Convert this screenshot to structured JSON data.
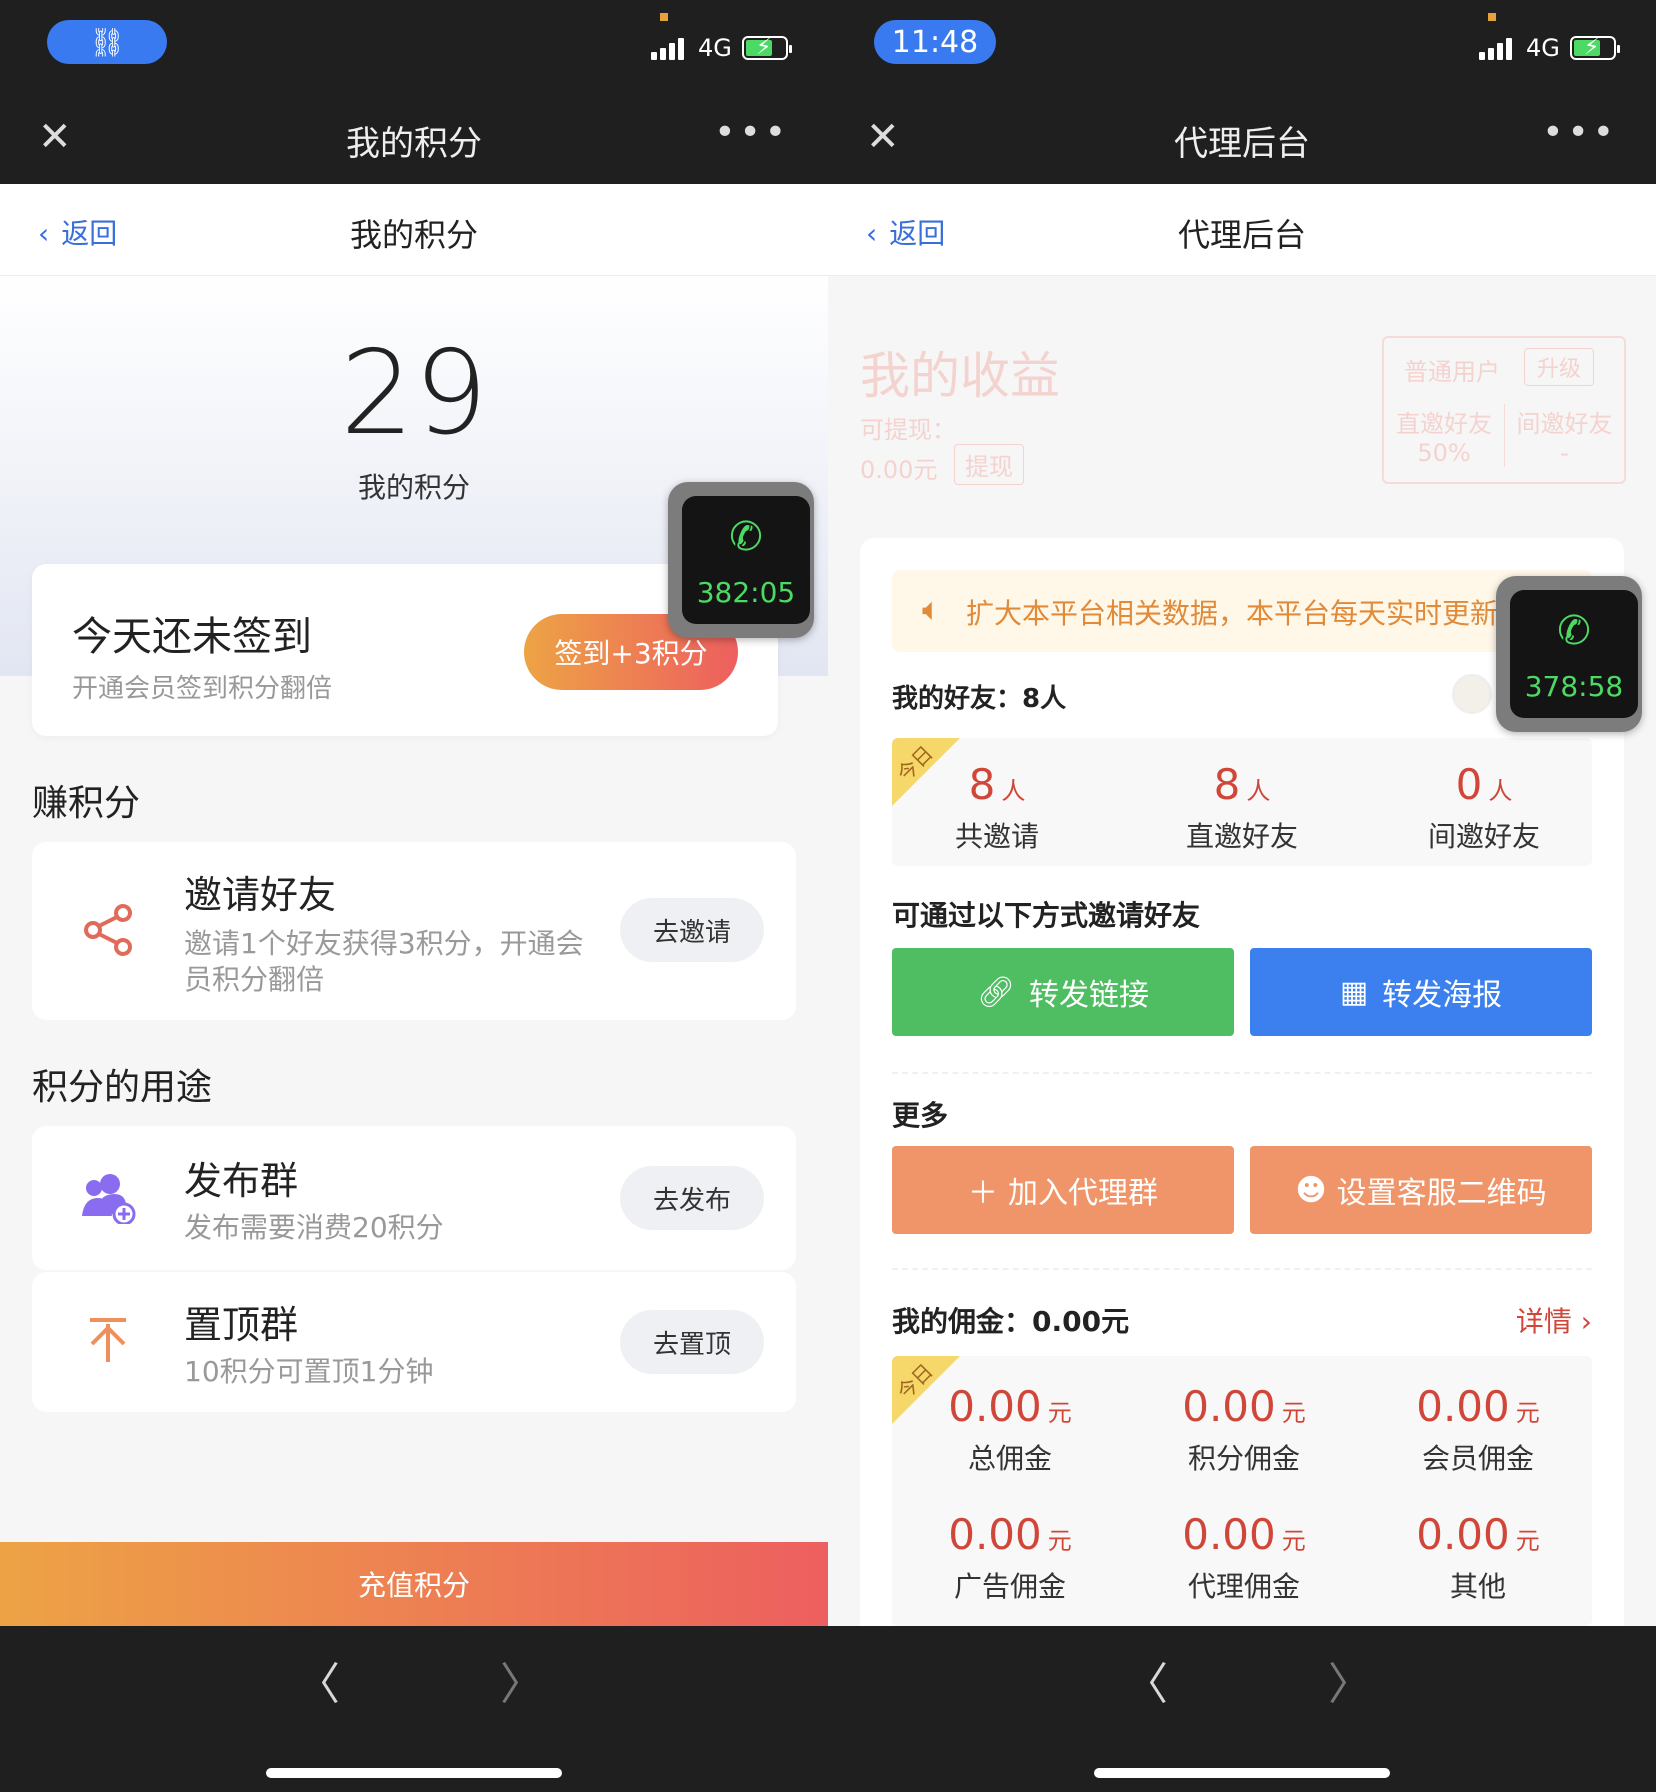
{
  "left": {
    "status": {
      "link_glyph": "⛓",
      "network": "4G"
    },
    "wx_title": "我的积分",
    "nav": {
      "back_label": "返回",
      "title": "我的积分"
    },
    "points": {
      "value": "29",
      "label": "我的积分"
    },
    "sign": {
      "title": "今天还未签到",
      "subtitle": "开通会员签到积分翻倍",
      "button": "签到+3积分"
    },
    "earn": {
      "heading": "赚积分",
      "items": [
        {
          "icon": "share-icon",
          "title": "邀请好友",
          "desc": "邀请1个好友获得3积分，开通会员积分翻倍",
          "action": "去邀请"
        }
      ]
    },
    "use": {
      "heading": "积分的用途",
      "items": [
        {
          "icon": "group-add-icon",
          "title": "发布群",
          "desc": "发布需要消费20积分",
          "action": "去发布"
        },
        {
          "icon": "pin-top-icon",
          "title": "置顶群",
          "desc": "10积分可置顶1分钟",
          "action": "去置顶"
        }
      ]
    },
    "recharge": "充值积分",
    "call": {
      "time": "382:05"
    }
  },
  "right": {
    "status": {
      "time": "11:48",
      "network": "4G"
    },
    "wx_title": "代理后台",
    "nav": {
      "back_label": "返回",
      "title": "代理后台"
    },
    "earnings": {
      "title": "我的收益",
      "withdrawable_label": "可提现：",
      "withdrawable_value": "0.00元",
      "withdraw_button": "提现",
      "level": "普通用户",
      "upgrade": "升级",
      "direct_label": "直邀好友",
      "direct_value": "50%",
      "indirect_label": "间邀好友",
      "indirect_value": "-"
    },
    "notice": "扩大本平台相关数据，本平台每天实时更新",
    "friends": {
      "label": "我的好友：",
      "count": "8人",
      "badge": "今日",
      "stats": [
        {
          "value": "8",
          "unit": "人",
          "label": "共邀请"
        },
        {
          "value": "8",
          "unit": "人",
          "label": "直邀好友"
        },
        {
          "value": "0",
          "unit": "人",
          "label": "间邀好友"
        }
      ]
    },
    "invite": {
      "heading": "可通过以下方式邀请好友",
      "link_button": "转发链接",
      "poster_button": "转发海报"
    },
    "more": {
      "heading": "更多",
      "join_button": "加入代理群",
      "qr_button": "设置客服二维码"
    },
    "commission": {
      "label": "我的佣金：",
      "value": "0.00元",
      "detail": "详情",
      "badge": "今日",
      "stats": [
        {
          "value": "0.00",
          "unit": "元",
          "label": "总佣金"
        },
        {
          "value": "0.00",
          "unit": "元",
          "label": "积分佣金"
        },
        {
          "value": "0.00",
          "unit": "元",
          "label": "会员佣金"
        },
        {
          "value": "0.00",
          "unit": "元",
          "label": "广告佣金"
        },
        {
          "value": "0.00",
          "unit": "元",
          "label": "代理佣金"
        },
        {
          "value": "0.00",
          "unit": "元",
          "label": "其他"
        }
      ]
    },
    "call": {
      "time": "378:58"
    }
  },
  "colors": {
    "accent_orange": "#eda345",
    "accent_red": "#ed5f5f",
    "green": "#4fbd62",
    "blue": "#3b80ee",
    "salmon": "#f0956a"
  }
}
